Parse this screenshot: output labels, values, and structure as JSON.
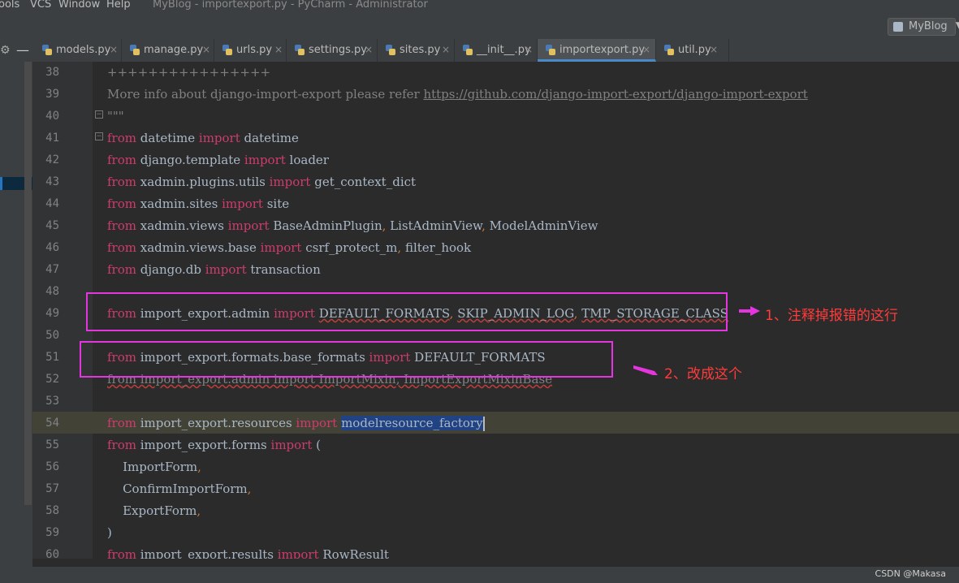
{
  "window": {
    "title": "MyBlog - importexport.py - PyCharm - Administrator",
    "menu": [
      "ools",
      "VCS",
      "Window",
      "Help"
    ]
  },
  "run_config": {
    "label": "MyBlog"
  },
  "tabs": [
    {
      "label": "models.py",
      "active": false
    },
    {
      "label": "manage.py",
      "active": false
    },
    {
      "label": "urls.py",
      "active": false
    },
    {
      "label": "settings.py",
      "active": false
    },
    {
      "label": "sites.py",
      "active": false
    },
    {
      "label": "__init__.py",
      "active": false
    },
    {
      "label": "importexport.py",
      "active": true
    },
    {
      "label": "util.py",
      "active": false
    }
  ],
  "icons": {
    "gear": "gear-icon",
    "minimize": "minus-icon",
    "tab_close": "close-icon",
    "python_file": "python-file-icon",
    "dropdown": "chevron-down-icon"
  },
  "editor": {
    "line_numbers": [
      "38",
      "39",
      "40",
      "41",
      "42",
      "43",
      "44",
      "45",
      "46",
      "47",
      "48",
      "49",
      "50",
      "51",
      "52",
      "53",
      "54",
      "55",
      "56",
      "57",
      "58",
      "59",
      "60"
    ],
    "lines": {
      "l38": "++++++++++++++++",
      "l39_text": "More info about django-import-export please refer ",
      "l39_link": "https://github.com/django-import-export/django-import-export",
      "l40": "\"\"\"",
      "l41": [
        "from",
        " datetime ",
        "import",
        " datetime"
      ],
      "l42": [
        "from",
        " django",
        ".",
        "template ",
        "import",
        " loader"
      ],
      "l43": [
        "from",
        " xadmin",
        ".",
        "plugins",
        ".",
        "utils ",
        "import",
        " get_context_dict"
      ],
      "l44": [
        "from",
        " xadmin",
        ".",
        "sites ",
        "import",
        " site"
      ],
      "l45": [
        "from",
        " xadmin",
        ".",
        "views ",
        "import",
        " BaseAdminPlugin",
        ",",
        " ListAdminView",
        ",",
        " ModelAdminView"
      ],
      "l46": [
        "from",
        " xadmin",
        ".",
        "views",
        ".",
        "base ",
        "import",
        " csrf_protect_m",
        ",",
        " filter_hook"
      ],
      "l47": [
        "from",
        " django",
        ".",
        "db ",
        "import",
        " transaction"
      ],
      "l49": [
        "from",
        " import_export",
        ".",
        "admin ",
        "import",
        " ",
        "DEFAULT_FORMATS",
        ",",
        " ",
        "SKIP_ADMIN_LOG",
        ",",
        " ",
        "TMP_STORAGE_CLASS"
      ],
      "l51": [
        "from",
        " import_export",
        ".",
        "formats",
        ".",
        "base_formats ",
        "import",
        " DEFAULT_FORMATS"
      ],
      "l52": "from import_export.admin import ImportMixin, ImportExportMixinBase",
      "l54": [
        "from",
        " import_export",
        ".",
        "resources ",
        "import",
        " ",
        "modelresource_factory"
      ],
      "l55": [
        "from",
        " import_export",
        ".",
        "forms ",
        "import",
        " ("
      ],
      "l56": [
        "    ImportForm",
        ","
      ],
      "l57": [
        "    ConfirmImportForm",
        ","
      ],
      "l58": [
        "    ExportForm",
        ","
      ],
      "l59": ")",
      "l60": [
        "from",
        " import_export",
        ".",
        "results ",
        "import",
        " RowResult"
      ]
    }
  },
  "annotations": {
    "note1": "1、注释掉报错的这行",
    "note2": "2、改成这个"
  },
  "watermark": "CSDN @Makasa",
  "colors": {
    "keyword": "#cf3c6b",
    "text": "#a9b7c6",
    "annotation_box": "#e535e0",
    "annotation_text": "#ff3b3b",
    "selection": "#214283"
  }
}
